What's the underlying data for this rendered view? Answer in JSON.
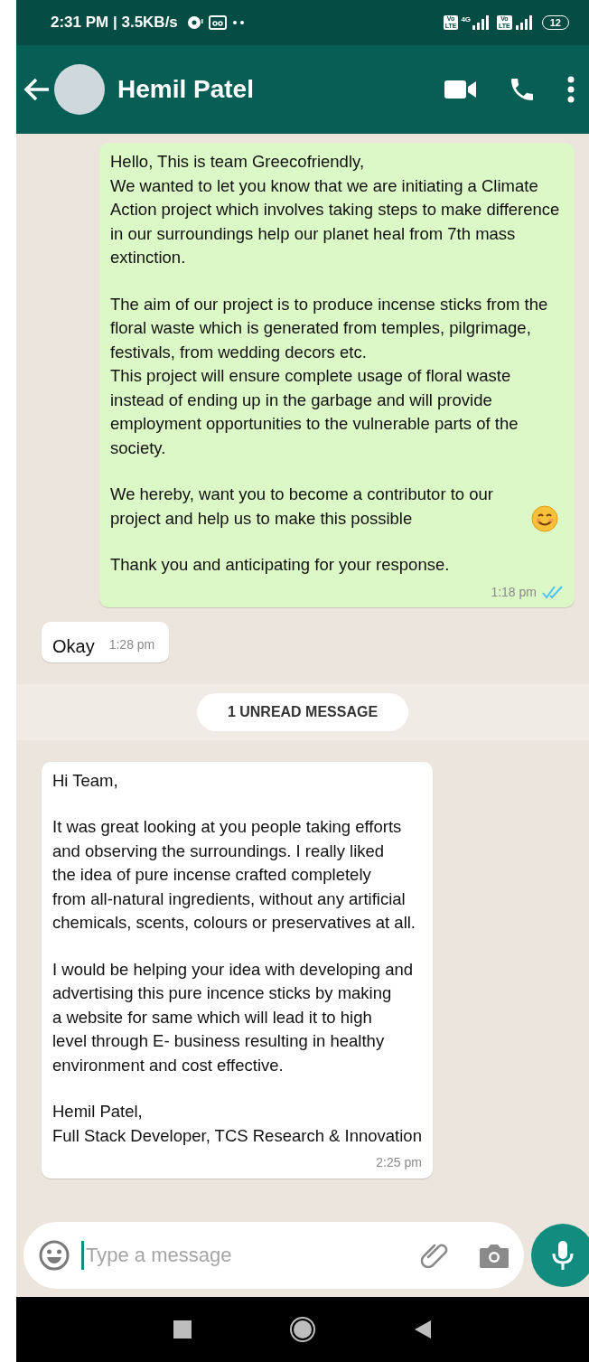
{
  "status_bar": {
    "time": "2:31 PM | 3.5KB/s",
    "network_badges": [
      {
        "top": "Vo",
        "bottom": "LTE",
        "tag": "4G"
      },
      {
        "top": "Vo",
        "bottom": "LTE"
      }
    ],
    "battery": "12"
  },
  "header": {
    "contact_name": "Hemil Patel"
  },
  "messages": [
    {
      "kind": "outgoing",
      "read": true,
      "time": "1:18 pm",
      "paragraphs": [
        {
          "kind": "text",
          "text": "Hello, This is team Greecofriendly,\nWe wanted to let you know that we are initiating a Climate Action project which involves taking steps to make difference in our surroundings help our planet heal from 7th mass extinction."
        },
        {
          "kind": "text",
          "text": "The aim of our project is to produce incense sticks from the floral waste which is generated from temples, pilgrimage, festivals, from wedding decors etc.\nThis project will ensure complete usage of floral waste instead of ending up in the garbage and will provide employment opportunities to the vulnerable parts of the society."
        },
        {
          "kind": "emoji_end",
          "text": "We hereby, want you to become a contributor to our project and help us to make this possible"
        },
        {
          "kind": "text",
          "text": "Thank you and anticipating for your response."
        }
      ]
    },
    {
      "kind": "incoming",
      "time": "1:28 pm",
      "paragraphs": [
        {
          "kind": "text",
          "text": "Okay"
        }
      ]
    },
    {
      "kind": "divider",
      "text": "1 UNREAD MESSAGE"
    },
    {
      "kind": "incoming",
      "time": "2:25 pm",
      "paragraphs": [
        {
          "kind": "text",
          "text": "Hi Team,"
        },
        {
          "kind": "text",
          "text": "It was great looking at you people taking efforts\nand observing the surroundings. I really liked\nthe idea of pure incense crafted completely\nfrom all-natural ingredients, without any artificial\nchemicals, scents, colours or preservatives at all."
        },
        {
          "kind": "text",
          "text": "I would be helping your idea with developing and\nadvertising this pure incence sticks by making\na website for same which will lead it to high\nlevel through E- business resulting in healthy\nenvironment and cost effective."
        },
        {
          "kind": "text",
          "text": "Hemil Patel,\nFull Stack Developer, TCS Research & Innovation"
        }
      ]
    }
  ],
  "composer": {
    "placeholder": "Type a message"
  }
}
